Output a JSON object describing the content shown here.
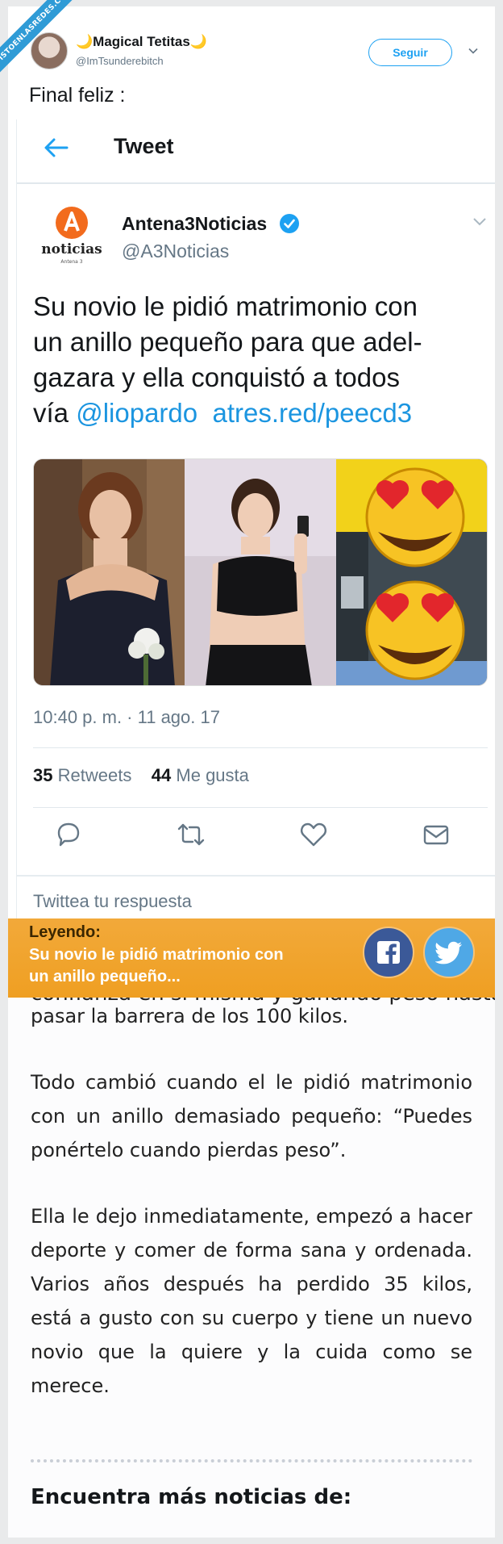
{
  "watermark": "VISTOENLASREDES.COM",
  "outer_tweet": {
    "display_name": "🌙Magical Tetitas🌙",
    "handle": "@ImTsunderebitch",
    "follow_label": "Seguir",
    "text": "Final feliz :"
  },
  "screenshot": {
    "header_title": "Tweet",
    "tweet": {
      "logo_text": "noticias",
      "logo_subtext": "Antena 3",
      "display_name": "Antena3Noticias",
      "handle": "@A3Noticias",
      "text_lines": [
        "Su novio le pidió matrimonio con",
        "un anillo pequeño para que adel-",
        "gazara y ella conquistó a todos"
      ],
      "text_prefix": "vía ",
      "mention": "@liopardo",
      "url": "atres.red/peecd3",
      "timestamp": "10:40 p. m. · 11 ago. 17",
      "retweets_count": "35",
      "retweets_label": "Retweets",
      "likes_count": "44",
      "likes_label": "Me gusta",
      "reply_prompt": "Twittea tu respuesta"
    }
  },
  "reading_bar": {
    "label": "Leyendo:",
    "title": "Su novio le pidió matrimonio con un anillo pequeño...",
    "facebook_icon": "facebook-icon",
    "twitter_icon": "twitter-icon"
  },
  "article": {
    "partial_line": "confianza en sí misma y ganando peso hasta",
    "paragraphs": [
      "pasar la barrera de los 100 kilos.",
      "Todo cambió cuando el le pidió matrimonio con un anillo demasiado pequeño: “Puedes ponértelo cuando pierdas peso”.",
      "Ella le dejo inmediatamente, empezó a hacer deporte y comer de forma sana y ordenada. Varios años después ha perdido 35 kilos, está a gusto con su cuerpo y tiene un nuevo novio que la quiere y la cuida como se merece."
    ],
    "more_news": "Encuentra más noticias de:"
  },
  "colors": {
    "accent": "#1da1f2",
    "link": "#1b95e0",
    "reading_bar": "#ef9f22",
    "facebook": "#3b5998",
    "twitter": "#4fa8e6"
  }
}
